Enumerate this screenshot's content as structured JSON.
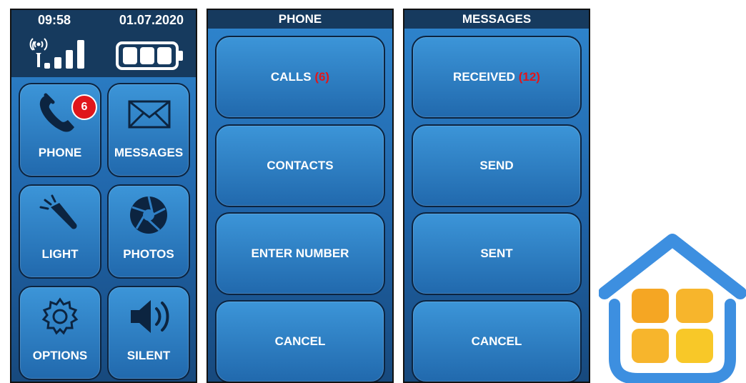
{
  "home": {
    "time": "09:58",
    "date": "01.07.2020",
    "tiles": [
      {
        "label": "PHONE",
        "icon": "phone-icon"
      },
      {
        "label": "MESSAGES",
        "icon": "envelope-icon"
      },
      {
        "label": "LIGHT",
        "icon": "flashlight-icon"
      },
      {
        "label": "PHOTOS",
        "icon": "camera-aperture-icon"
      },
      {
        "label": "OPTIONS",
        "icon": "gear-icon"
      },
      {
        "label": "SILENT",
        "icon": "speaker-icon"
      }
    ],
    "phone_badge": "6"
  },
  "phone_menu": {
    "title": "PHONE",
    "calls_label": "CALLS",
    "calls_count": "(6)",
    "contacts": "CONTACTS",
    "enter_number": "ENTER NUMBER",
    "cancel": "CANCEL"
  },
  "messages_menu": {
    "title": "MESSAGES",
    "received_label": "RECEIVED",
    "received_count": "(12)",
    "send": "SEND",
    "sent": "SENT",
    "cancel": "CANCEL"
  },
  "colors": {
    "header": "#163a5e",
    "tile_top": "#3c95d8",
    "tile_bottom": "#2169ad",
    "count_red": "#e0161b",
    "logo_blue": "#3d8fe0",
    "logo_orange": "#f5a623",
    "logo_yellow": "#f8c828"
  }
}
